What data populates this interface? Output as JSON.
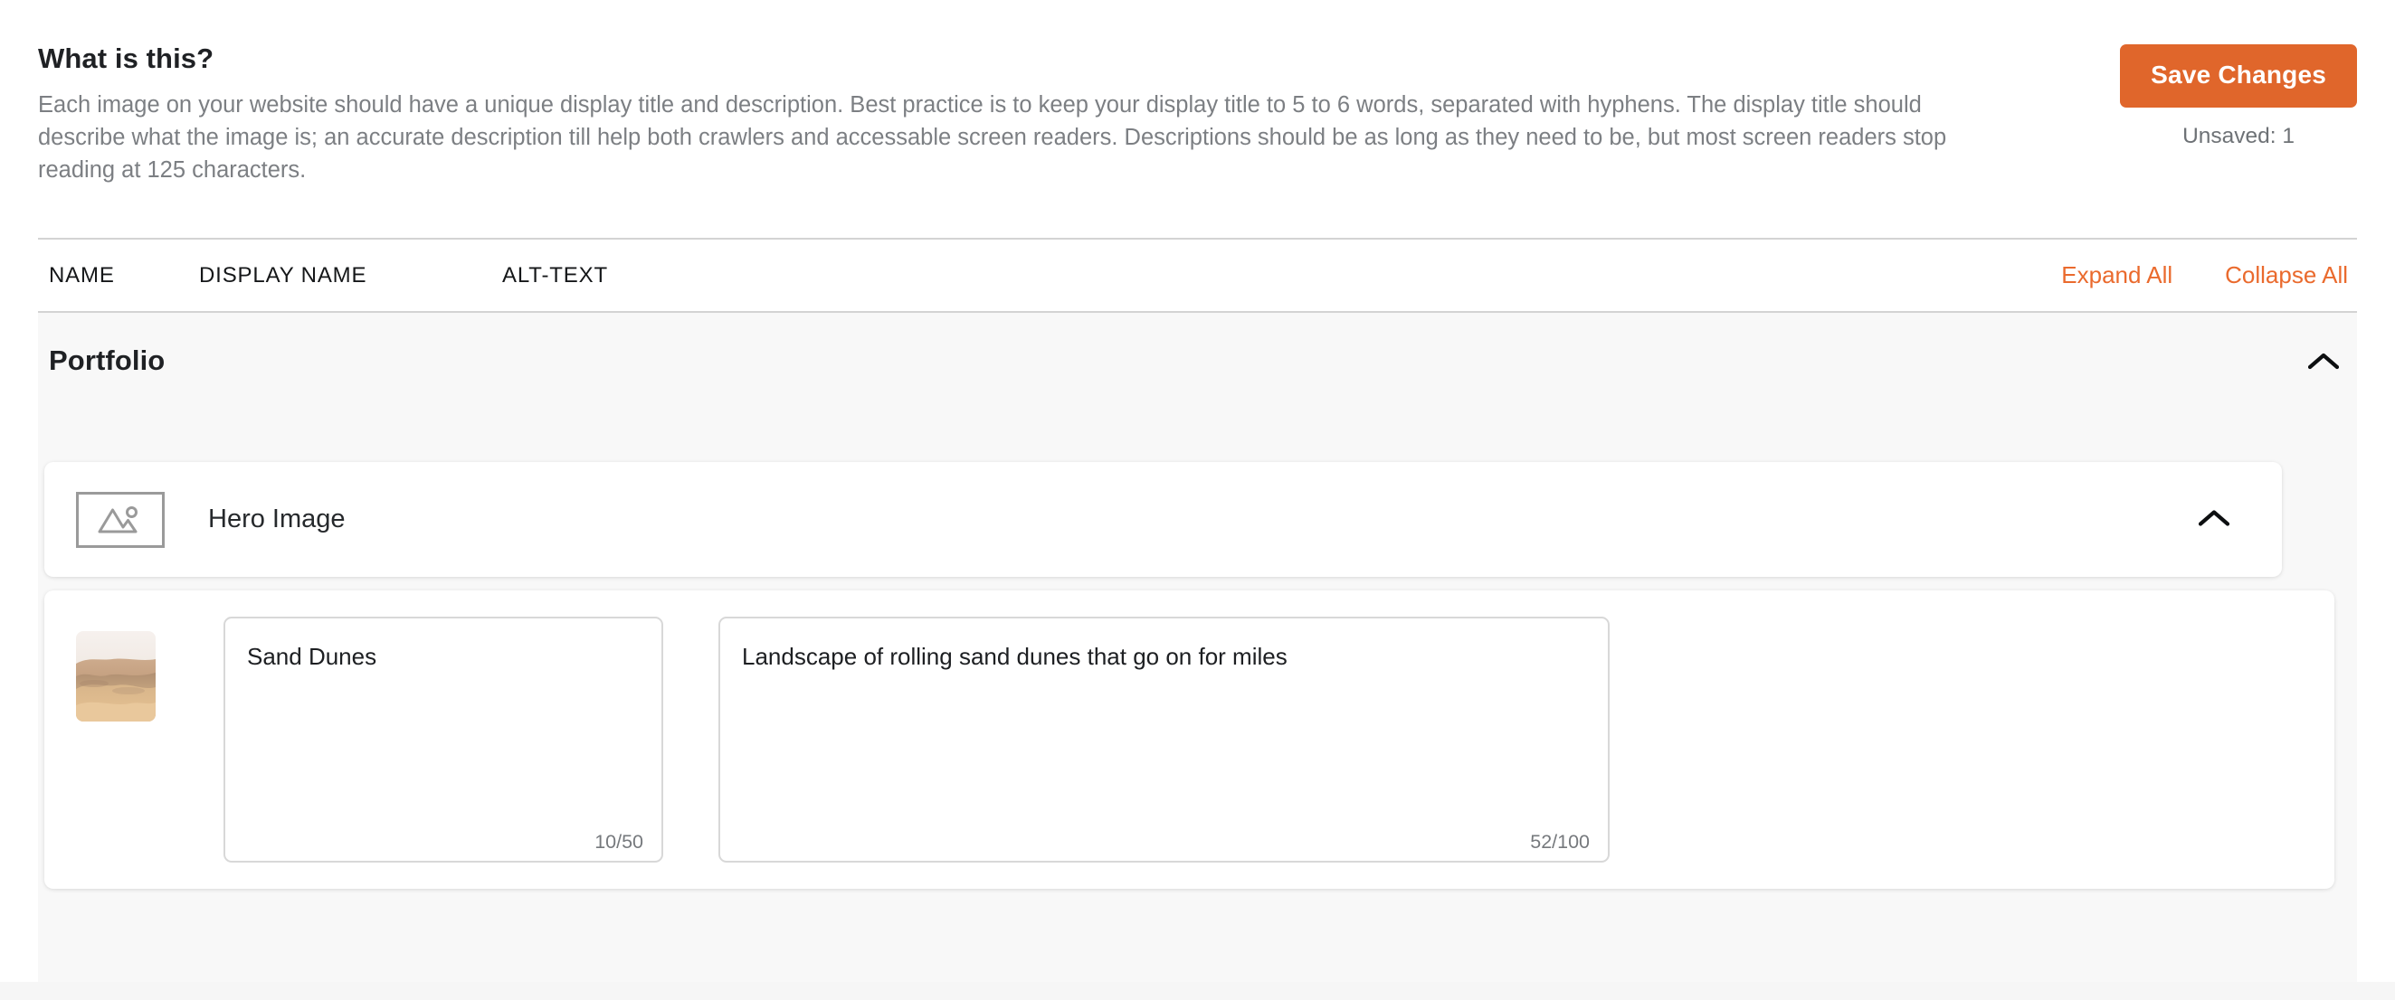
{
  "intro": {
    "title": "What is this?",
    "body": "Each image on your website should have a unique display title and description. Best practice is to keep your display title to 5 to 6 words, separated with hyphens. The display title should describe what the image is; an accurate description till help both crawlers and accessable screen readers. Descriptions should be as long as they need to be, but most screen readers stop reading at 125 characters."
  },
  "actions": {
    "save_label": "Save Changes",
    "unsaved_label": "Unsaved: 1",
    "expand_all": "Expand All",
    "collapse_all": "Collapse All"
  },
  "columns": {
    "name": "NAME",
    "display_name": "DISPLAY NAME",
    "alt_text": "ALT-TEXT"
  },
  "group": {
    "title": "Portfolio",
    "collapse_icon": "chevron-up-icon"
  },
  "rows": [
    {
      "name": "Hero Image",
      "thumbnail": "image-placeholder-icon",
      "collapse_icon": "chevron-up-icon"
    },
    {
      "thumbnail": "sand-dunes-photo",
      "display_name": {
        "value": "Sand Dunes",
        "placeholder": "Display name",
        "counter": "10/50"
      },
      "alt_text": {
        "value": "Landscape of rolling sand dunes that go on for miles",
        "placeholder": "Alt text",
        "counter": "52/100"
      }
    }
  ],
  "colors": {
    "accent": "#e0662b",
    "link": "#ea6a2d",
    "group_bg": "#f8f8f8",
    "muted_text": "#7c7f83"
  }
}
